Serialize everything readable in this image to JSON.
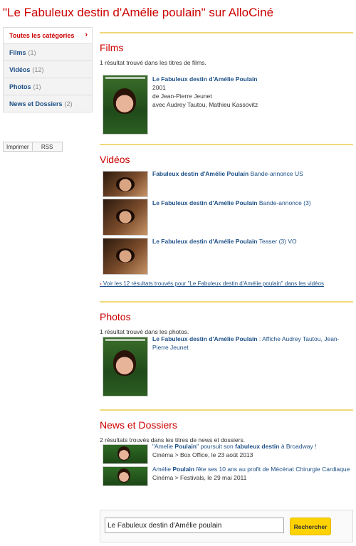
{
  "page_title": "\"Le Fabuleux destin d'Amélie poulain\" sur AlloCiné",
  "sidebar": {
    "items": [
      {
        "label": "Toutes les catégories",
        "count": "",
        "chevron": "›"
      },
      {
        "label": "Films",
        "count": "(1)"
      },
      {
        "label": "Vidéos",
        "count": "(12)"
      },
      {
        "label": "Photos",
        "count": "(1)"
      },
      {
        "label": "News et Dossiers",
        "count": "(2)"
      }
    ]
  },
  "tools": {
    "print_label": "Imprimer",
    "rss_label": "RSS"
  },
  "films": {
    "title": "Films",
    "subtitle": "1 résultat trouvé dans les titres de films.",
    "result": {
      "title": "Le Fabuleux destin d'Amélie Poulain",
      "year": "2001",
      "director": "de Jean-Pierre Jeunet",
      "cast": "avec Audrey Tautou, Mathieu Kassovitz",
      "poster_text": "le Fabuleux Destin d'Amélie Poulain"
    }
  },
  "videos": {
    "title": "Vidéos",
    "items": [
      {
        "title": "Fabuleux destin d'Amélie Poulain",
        "suffix": " Bande-annonce US"
      },
      {
        "title": "Le Fabuleux destin d'Amélie Poulain",
        "suffix": " Bande-annonce (3)"
      },
      {
        "title": "Le Fabuleux destin d'Amélie Poulain",
        "suffix": " Teaser (3) VO"
      }
    ],
    "more_link": "Voir les 12 résultats trouvés pour \"Le Fabuleux destin d'Amélie poulain\" dans les vidéos"
  },
  "photos": {
    "title": "Photos",
    "subtitle": "1 résultat trouvé dans les photos.",
    "result": {
      "title": "Le Fabuleux destin d'Amélie Poulain",
      "suffix": " : Affiche Audrey Tautou, Jean-Pierre Jeunet"
    }
  },
  "news": {
    "title": "News et Dossiers",
    "subtitle": "2 résultats trouvés dans les titres de news et dossiers.",
    "items": [
      {
        "line1_a": "\"Amelie ",
        "line1_b": "Poulain",
        "line1_c": "\" poursuit son ",
        "line1_d": "fabuleux destin",
        "line1_e": " à Broadway !",
        "meta": "Cinéma > Box Office, le 23 août 2013"
      },
      {
        "line1_a": "Amélie ",
        "line1_b": "Poulain",
        "line1_c": " fête ses 10 ans au profit de Mécénat Chirurgie Cardiaque",
        "meta": "Cinéma > Festivals, le 29 mai 2011"
      }
    ]
  },
  "search": {
    "value": "Le Fabuleux destin d'Amélie poulain",
    "button_label": "Rechercher"
  },
  "colors": {
    "accent_red": "#cc0000",
    "link_blue": "#1c4f87",
    "rule_yellow": "#f0d879",
    "button_yellow": "#ffd200"
  }
}
